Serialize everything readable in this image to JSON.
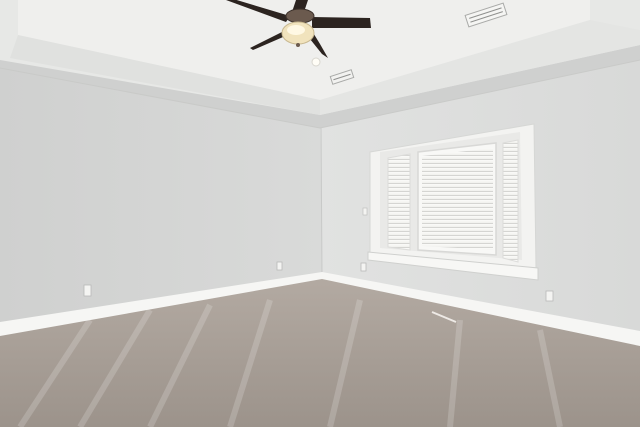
{
  "scene": {
    "subject": "empty-bedroom",
    "colors": {
      "wall_left": "#d6d7d6",
      "wall_right": "#dedfde",
      "ceiling": "#ebecea",
      "trim": "#f6f6f4",
      "carpet": "#a89f97",
      "fan_blade": "#2c2420",
      "fan_light": "#f1e3bd",
      "window_glass": "#f7f7f5"
    }
  }
}
